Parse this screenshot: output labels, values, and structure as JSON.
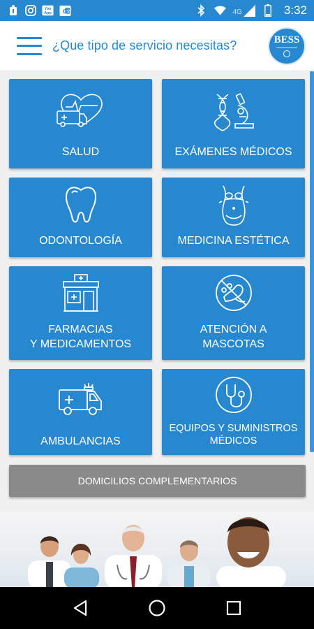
{
  "status_bar": {
    "time": "3:32",
    "network": "4G",
    "icons": [
      "notification-icon",
      "instagram-icon",
      "youtube-app-icon",
      "translate-icon",
      "bluetooth-icon",
      "wifi-icon",
      "cell-signal-icon",
      "battery-icon"
    ]
  },
  "header": {
    "title": "¿Que tipo de servicio necesitas?",
    "menu_icon": "hamburger-menu-icon",
    "logo_text": "BESS"
  },
  "services": [
    {
      "label": "SALUD",
      "icon": "ambulance-heart-icon"
    },
    {
      "label": "EXÁMENES MÉDICOS",
      "icon": "dna-microscope-icon"
    },
    {
      "label": "ODONTOLOGÍA",
      "icon": "tooth-icon"
    },
    {
      "label": "MEDICINA ESTÉTICA",
      "icon": "body-silhouette-icon"
    },
    {
      "label": "FARMACIAS\nY MEDICAMENTOS",
      "icon": "pharmacy-building-icon"
    },
    {
      "label": "ATENCIÓN A\nMASCOTAS",
      "icon": "pet-paw-icon"
    },
    {
      "label": "AMBULANCIAS",
      "icon": "ambulance-icon"
    },
    {
      "label": "EQUIPOS Y SUMINISTROS\nMÉDICOS",
      "icon": "stethoscope-icon"
    }
  ],
  "extra_button": {
    "label": "DOMICILIOS COMPLEMENTARIOS"
  },
  "banner": {
    "description_icon": "doctors-team-image"
  },
  "nav": {
    "back": "back-icon",
    "home": "home-icon",
    "recents": "recents-icon"
  },
  "colors": {
    "primary": "#2788cf",
    "secondary_button": "#8a8a8a",
    "background": "#f0f0f0"
  }
}
